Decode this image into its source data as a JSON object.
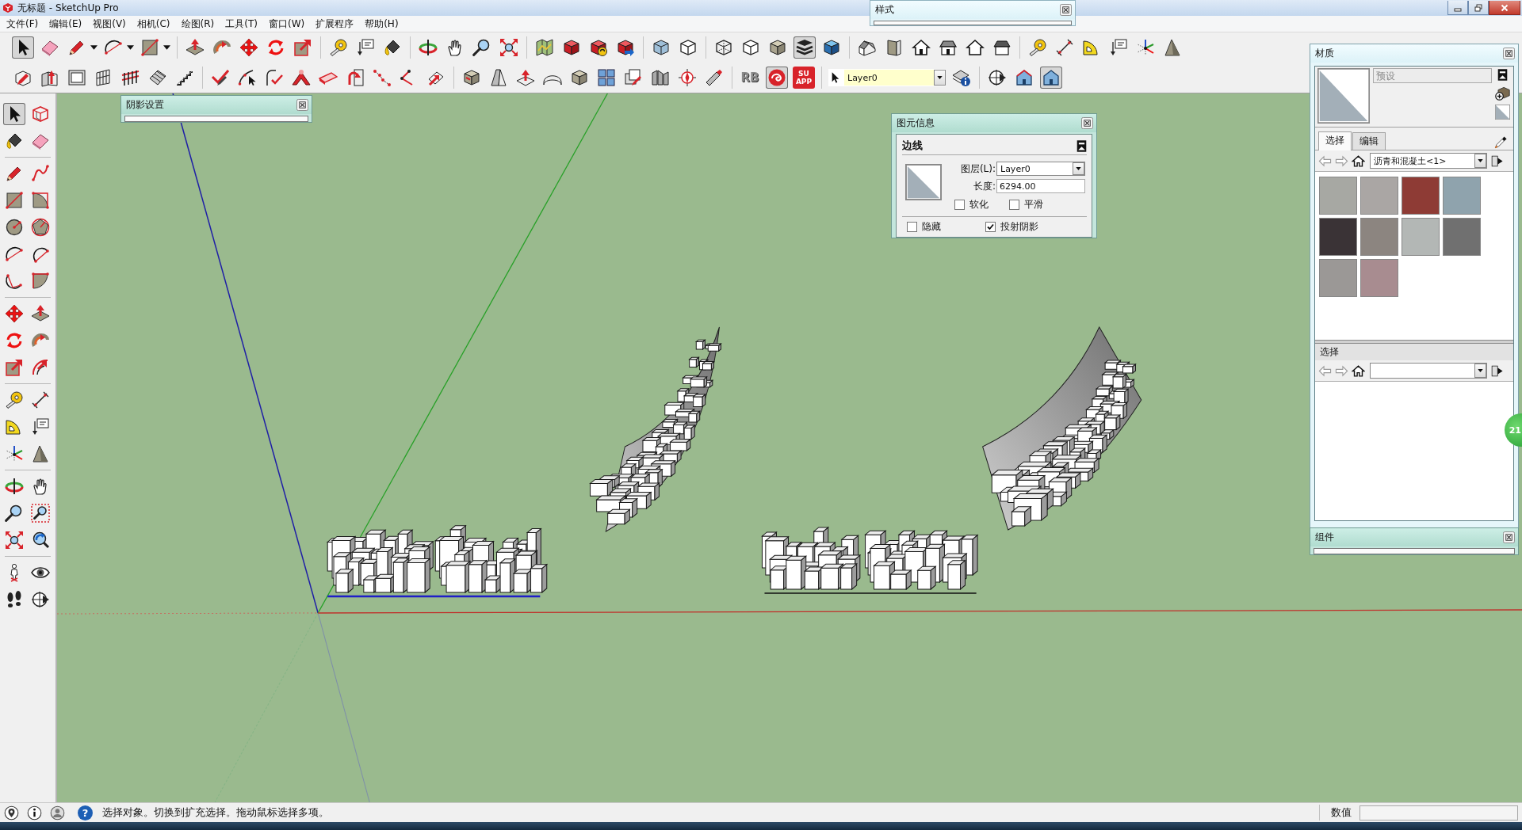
{
  "window": {
    "title": "无标题 - SketchUp Pro"
  },
  "menu": [
    "文件(F)",
    "编辑(E)",
    "视图(V)",
    "相机(C)",
    "绘图(R)",
    "工具(T)",
    "窗口(W)",
    "扩展程序",
    "帮助(H)"
  ],
  "toolbar_row_1": [
    {
      "selected": true
    },
    {
      "selected": false
    },
    {
      "selected": false
    },
    {
      "selected": false
    },
    {
      "selected": false
    },
    {
      "selected": false
    },
    {
      "selected": false
    },
    {
      "selected": false
    },
    {
      "selected": false
    },
    {
      "selected": false
    },
    {
      "selected": false
    },
    {
      "selected": false
    },
    {
      "selected": false
    },
    {
      "selected": false
    },
    {
      "selected": false
    },
    {
      "selected": false
    },
    {
      "selected": false
    },
    {
      "selected": false
    },
    {
      "selected": false
    },
    {
      "selected": false
    },
    {
      "selected": false
    },
    {
      "selected": false
    },
    {
      "selected": false
    },
    {
      "selected": false
    },
    {
      "selected": false
    },
    {
      "selected": false
    },
    {
      "selected": true
    },
    {
      "selected": false
    },
    {
      "selected": false
    },
    {
      "selected": false
    },
    {
      "selected": false
    },
    {
      "selected": false
    },
    {
      "selected": false
    },
    {
      "selected": false
    },
    {
      "selected": false
    },
    {
      "selected": false
    },
    {
      "selected": false
    },
    {
      "selected": false
    },
    {
      "selected": false
    },
    {
      "selected": false
    }
  ],
  "toolbar_row_2": {
    "tools": [
      {
        "selected": false
      },
      {
        "selected": false
      },
      {
        "selected": false
      },
      {
        "selected": false
      },
      {
        "selected": false
      },
      {
        "selected": false
      },
      {
        "selected": false
      },
      {
        "selected": false
      },
      {
        "selected": false
      },
      {
        "selected": false
      },
      {
        "selected": false
      },
      {
        "selected": false
      },
      {
        "selected": false
      },
      {
        "selected": false
      },
      {
        "selected": false
      },
      {
        "selected": false
      },
      {
        "selected": false
      },
      {
        "selected": false
      },
      {
        "selected": false
      },
      {
        "selected": false
      },
      {
        "selected": false
      },
      {
        "selected": false
      },
      {
        "selected": false
      },
      {
        "selected": false
      },
      {
        "selected": false
      },
      {
        "selected": false
      }
    ],
    "plugins": [
      {
        "kind": "text",
        "label": "RB",
        "selected": false
      },
      {
        "kind": "icon",
        "selected": true
      },
      {
        "kind": "tile",
        "label": "SU APP",
        "selected": false
      }
    ],
    "layer": {
      "value": "Layer0"
    },
    "view_tools": [
      {
        "selected": false
      },
      {
        "selected": false
      },
      {
        "selected": true
      }
    ]
  },
  "left_toolbar": [
    {
      "selected": true
    },
    {
      "selected": false
    },
    {
      "selected": false
    },
    {
      "selected": false
    },
    {
      "selected": false
    },
    {
      "selected": false
    },
    {
      "selected": false
    },
    {
      "selected": false
    },
    {
      "selected": false
    },
    {
      "selected": false
    },
    {
      "selected": false
    },
    {
      "selected": false
    },
    {
      "selected": false
    },
    {
      "selected": false
    },
    {
      "selected": false
    },
    {
      "selected": false
    },
    {
      "selected": false
    },
    {
      "selected": false
    },
    {
      "selected": false
    },
    {
      "selected": false
    },
    {
      "selected": false
    },
    {
      "selected": false
    },
    {
      "selected": false
    },
    {
      "selected": false
    },
    {
      "selected": false
    },
    {
      "selected": false
    },
    {
      "selected": false
    },
    {
      "selected": false
    },
    {
      "selected": false
    },
    {
      "selected": false
    },
    {
      "selected": false
    },
    {
      "selected": false
    },
    {
      "selected": false
    },
    {
      "selected": false
    },
    {
      "selected": false
    },
    {
      "selected": false
    }
  ],
  "styles_dialog": {
    "title": "样式"
  },
  "shadow_dialog": {
    "title": "阴影设置"
  },
  "entity_info": {
    "title": "图元信息",
    "type": "边线",
    "layer_label": "图层(L):",
    "layer_value": "Layer0",
    "length_label": "长度:",
    "length_value": "6294.00",
    "checkboxes": [
      {
        "label": "软化",
        "checked": false
      },
      {
        "label": "平滑",
        "checked": false
      },
      {
        "label": "隐藏",
        "checked": false
      },
      {
        "label": "投射阴影",
        "checked": true
      }
    ]
  },
  "materials": {
    "title": "材质",
    "name_placeholder": "预设",
    "tabs": [
      {
        "label": "选择",
        "selected": true
      },
      {
        "label": "编辑",
        "selected": false
      }
    ],
    "library": "沥青和混凝土<1>",
    "swatches": [
      {
        "color": "#a7a8a3"
      },
      {
        "color": "#aaa6a4"
      },
      {
        "color": "#8e3b35"
      },
      {
        "color": "#8fa3ad"
      },
      {
        "color": "#3a3336"
      },
      {
        "color": "#8c8580"
      },
      {
        "color": "#b3b7b5"
      },
      {
        "color": "#707070"
      },
      {
        "color": "#9b9896"
      },
      {
        "color": "#a88c90"
      }
    ],
    "lower_header": "选择"
  },
  "components": {
    "title": "组件"
  },
  "badge": "21",
  "status_bar": {
    "help_glyph": "?",
    "message": "选择对象。切换到扩充选择。拖动鼠标选择多项。",
    "measurements_label": "数值"
  }
}
